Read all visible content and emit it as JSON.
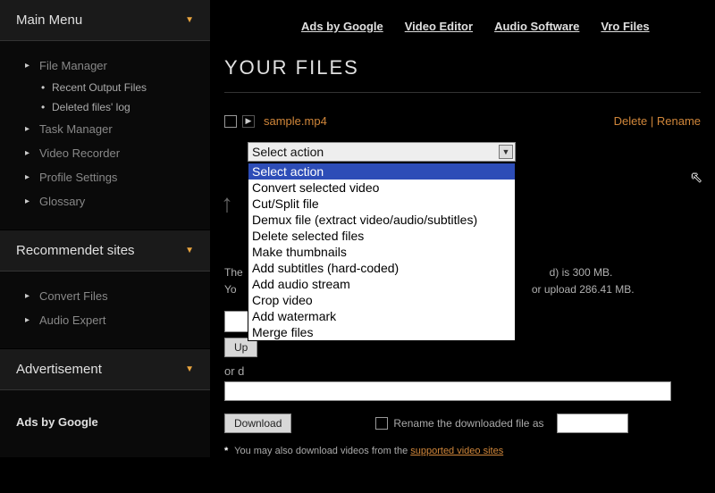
{
  "sidebar": {
    "main_menu": {
      "title": "Main Menu",
      "items": [
        {
          "label": "File Manager"
        },
        {
          "label": "Task Manager"
        },
        {
          "label": "Video Recorder"
        },
        {
          "label": "Profile Settings"
        },
        {
          "label": "Glossary"
        }
      ],
      "sub_items": [
        {
          "label": "Recent Output Files"
        },
        {
          "label": "Deleted files' log"
        }
      ]
    },
    "recommended": {
      "title": "Recommendet sites",
      "items": [
        {
          "label": "Convert Files"
        },
        {
          "label": "Audio Expert"
        }
      ]
    },
    "advertisement": {
      "title": "Advertisement",
      "ads_by_google": "Ads by Google"
    }
  },
  "top_links": [
    "Ads by Google",
    "Video Editor",
    "Audio Software",
    "Vro Files"
  ],
  "page_title": "YOUR FILES",
  "file": {
    "name": "sample.mp4",
    "delete": "Delete",
    "rename": "Rename"
  },
  "select": {
    "placeholder": "Select action",
    "options": [
      "Select action",
      "Convert selected video",
      "Cut/Split file",
      "Demux file (extract video/audio/subtitles)",
      "Delete selected files",
      "Make thumbnails",
      "Add subtitles (hard-coded)",
      "Add audio stream",
      "Crop video",
      "Add watermark",
      "Merge files"
    ]
  },
  "info": {
    "line1_suffix": "d) is 300 MB.",
    "line2_prefix": "Yo",
    "line2_suffix": "or upload 286.41 MB."
  },
  "upload_btn": "Up",
  "or_download": "or d",
  "download_btn": "Download",
  "rename_checkbox": "Rename the downloaded file as",
  "footnote": {
    "text": "You may also download videos from the ",
    "link": "supported video sites"
  }
}
